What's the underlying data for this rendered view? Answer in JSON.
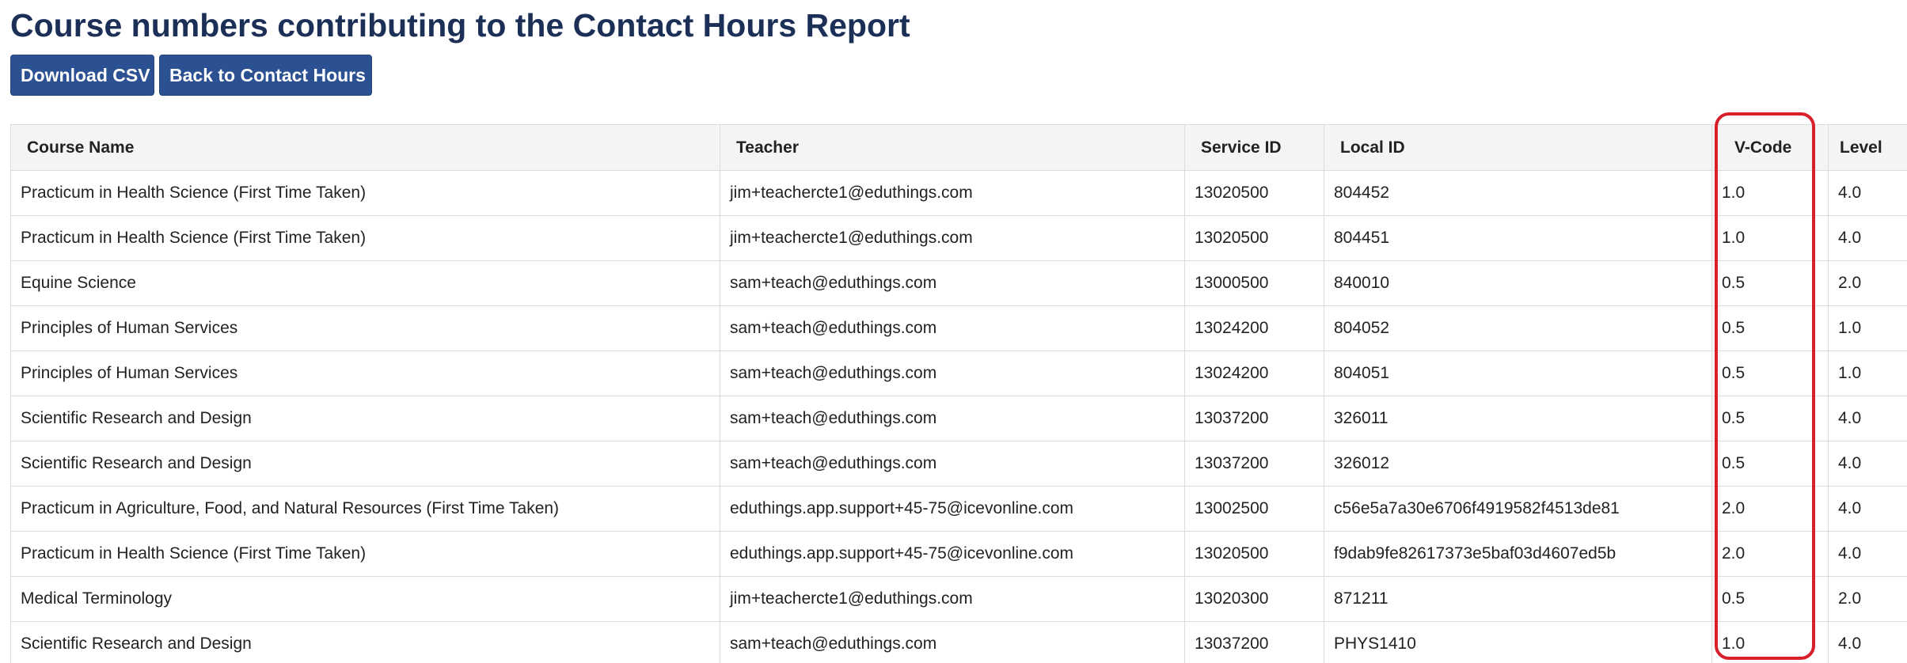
{
  "page": {
    "title": "Course numbers contributing to the Contact Hours Report"
  },
  "toolbar": {
    "download_label": "Download CSV",
    "back_label": "Back to Contact Hours"
  },
  "table": {
    "headers": {
      "course_name": "Course Name",
      "teacher": "Teacher",
      "service_id": "Service ID",
      "local_id": "Local ID",
      "v_code": "V-Code",
      "level": "Level"
    },
    "rows": [
      {
        "course_name": "Practicum in Health Science (First Time Taken)",
        "teacher": "jim+teachercte1@eduthings.com",
        "service_id": "13020500",
        "local_id": "804452",
        "v_code": "1.0",
        "level": "4.0"
      },
      {
        "course_name": "Practicum in Health Science (First Time Taken)",
        "teacher": "jim+teachercte1@eduthings.com",
        "service_id": "13020500",
        "local_id": "804451",
        "v_code": "1.0",
        "level": "4.0"
      },
      {
        "course_name": "Equine Science",
        "teacher": "sam+teach@eduthings.com",
        "service_id": "13000500",
        "local_id": "840010",
        "v_code": "0.5",
        "level": "2.0"
      },
      {
        "course_name": "Principles of Human Services",
        "teacher": "sam+teach@eduthings.com",
        "service_id": "13024200",
        "local_id": "804052",
        "v_code": "0.5",
        "level": "1.0"
      },
      {
        "course_name": "Principles of Human Services",
        "teacher": "sam+teach@eduthings.com",
        "service_id": "13024200",
        "local_id": "804051",
        "v_code": "0.5",
        "level": "1.0"
      },
      {
        "course_name": "Scientific Research and Design",
        "teacher": "sam+teach@eduthings.com",
        "service_id": "13037200",
        "local_id": "326011",
        "v_code": "0.5",
        "level": "4.0"
      },
      {
        "course_name": "Scientific Research and Design",
        "teacher": "sam+teach@eduthings.com",
        "service_id": "13037200",
        "local_id": "326012",
        "v_code": "0.5",
        "level": "4.0"
      },
      {
        "course_name": "Practicum in Agriculture, Food, and Natural Resources (First Time Taken)",
        "teacher": "eduthings.app.support+45-75@icevonline.com",
        "service_id": "13002500",
        "local_id": "c56e5a7a30e6706f4919582f4513de81",
        "v_code": "2.0",
        "level": "4.0"
      },
      {
        "course_name": "Practicum in Health Science (First Time Taken)",
        "teacher": "eduthings.app.support+45-75@icevonline.com",
        "service_id": "13020500",
        "local_id": "f9dab9fe82617373e5baf03d4607ed5b",
        "v_code": "2.0",
        "level": "4.0"
      },
      {
        "course_name": "Medical Terminology",
        "teacher": "jim+teachercte1@eduthings.com",
        "service_id": "13020300",
        "local_id": "871211",
        "v_code": "0.5",
        "level": "2.0"
      },
      {
        "course_name": "Scientific Research and Design",
        "teacher": "sam+teach@eduthings.com",
        "service_id": "13037200",
        "local_id": "PHYS1410",
        "v_code": "1.0",
        "level": "4.0"
      }
    ]
  },
  "annotation": {
    "color": "#d7202a"
  }
}
